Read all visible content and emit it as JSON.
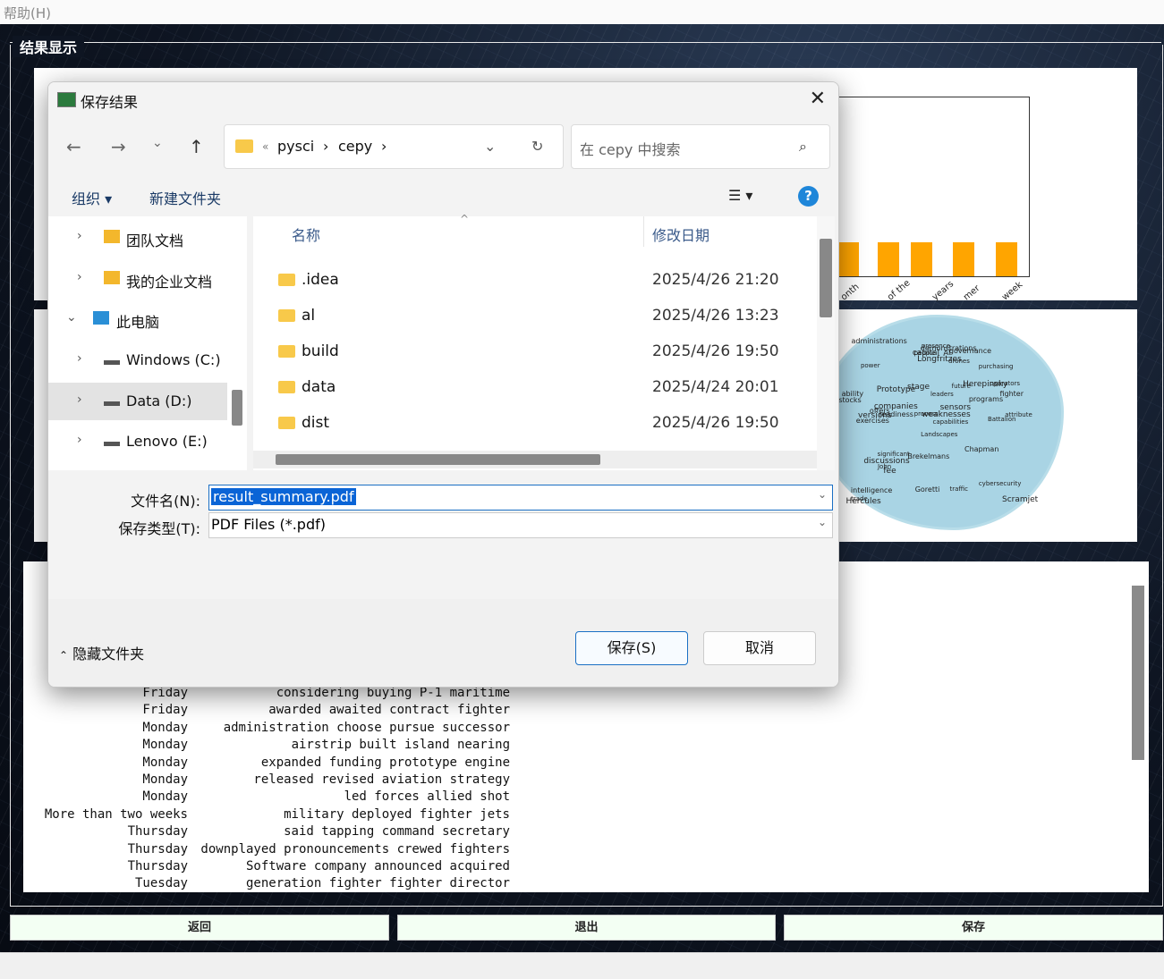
{
  "menubar": {
    "help": "帮助(H)"
  },
  "group": {
    "title": "结果显示"
  },
  "chart": {
    "x_tick_labels": [
      "onth",
      "of the",
      "years",
      "mer",
      "week"
    ],
    "bar_values": [
      0.47,
      0.47,
      0.47,
      0.47,
      0.47
    ]
  },
  "wordcloud": {
    "words": [
      "Landscapes",
      "readiness",
      "intelligence",
      "stage",
      "governance",
      "significant",
      "capabilities",
      "Hercules",
      "versions",
      "offers",
      "future",
      "attribute",
      "leaders",
      "programs",
      "trade",
      "Battalion",
      "sensors",
      "drones",
      "people",
      "Brekelmans",
      "fighter",
      "weaknesses",
      "process",
      "John",
      "fee",
      "Scramjet",
      "Chapman",
      "ability",
      "companies",
      "Herepinsky",
      "stocks",
      "capital",
      "Goretti",
      "Longfritzes",
      "operators",
      "discussions",
      "traffic",
      "purchasing",
      "administrations",
      "cybersecurity",
      "presence",
      "demonstrations",
      "Prototype",
      "power",
      "AI",
      "exercises"
    ]
  },
  "results": {
    "rows": [
      {
        "day": "Friday",
        "text": "considering buying P-1 maritime"
      },
      {
        "day": "Friday",
        "text": "awarded awaited contract fighter"
      },
      {
        "day": "Monday",
        "text": "administration choose pursue successor"
      },
      {
        "day": "Monday",
        "text": "airstrip built island nearing"
      },
      {
        "day": "Monday",
        "text": "expanded funding prototype engine"
      },
      {
        "day": "Monday",
        "text": "released revised aviation strategy"
      },
      {
        "day": "Monday",
        "text": "led forces allied shot"
      },
      {
        "day": "More than two weeks",
        "text": "military deployed fighter jets"
      },
      {
        "day": "Thursday",
        "text": "said tapping command secretary"
      },
      {
        "day": "Thursday",
        "text": "downplayed pronouncements crewed fighters"
      },
      {
        "day": "Thursday",
        "text": "Software company announced acquired"
      },
      {
        "day": "Tuesday",
        "text": "generation fighter fighter director"
      }
    ]
  },
  "bottom_buttons": {
    "back": "返回",
    "exit": "退出",
    "save": "保存"
  },
  "dialog": {
    "title": "保存结果",
    "path": {
      "root_marker": "«",
      "segment1": "pysci",
      "segment2": "cepy"
    },
    "search_placeholder": "在 cepy 中搜索",
    "organize": "组织 ▾",
    "new_folder": "新建文件夹",
    "tree": [
      {
        "label": "团队文档",
        "expanded": false
      },
      {
        "label": "我的企业文档",
        "expanded": false
      },
      {
        "label": "此电脑",
        "expanded": true
      },
      {
        "label": "Windows (C:)",
        "expanded": false
      },
      {
        "label": "Data (D:)",
        "expanded": false,
        "selected": true
      },
      {
        "label": "Lenovo  (E:)",
        "expanded": false
      }
    ],
    "columns": {
      "name": "名称",
      "date": "修改日期"
    },
    "files": [
      {
        "name": ".idea",
        "date": "2025/4/26 21:20"
      },
      {
        "name": "al",
        "date": "2025/4/26 13:23"
      },
      {
        "name": "build",
        "date": "2025/4/26 19:50"
      },
      {
        "name": "data",
        "date": "2025/4/24 20:01"
      },
      {
        "name": "dist",
        "date": "2025/4/26 19:50"
      }
    ],
    "filename_label": "文件名(N):",
    "filename_value": "result_summary.pdf",
    "filetype_label": "保存类型(T):",
    "filetype_value": "PDF Files (*.pdf)",
    "hide_folders": "隐藏文件夹",
    "save_button": "保存(S)",
    "cancel_button": "取消"
  },
  "colors": {
    "bar": "#ffa500",
    "accent": "#1e86d9",
    "selection": "#0a64d6"
  }
}
